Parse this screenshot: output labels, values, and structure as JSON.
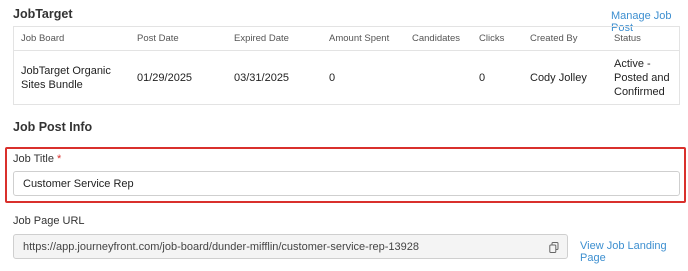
{
  "jobtarget": {
    "title": "JobTarget",
    "manage_link": "Manage Job Post",
    "columns": [
      "Job Board",
      "Post Date",
      "Expired Date",
      "Amount Spent",
      "Candidates",
      "Clicks",
      "Created By",
      "Status"
    ],
    "row": {
      "job_board": "JobTarget Organic Sites Bundle",
      "post_date": "01/29/2025",
      "expired_date": "03/31/2025",
      "amount_spent": "0",
      "candidates": "",
      "clicks": "0",
      "created_by": "Cody Jolley",
      "status": "Active - Posted and Confirmed"
    }
  },
  "job_post_info": {
    "title": "Job Post Info",
    "job_title_label": "Job Title",
    "required_marker": "*",
    "job_title_value": "Customer Service Rep",
    "job_page_url_label": "Job Page URL",
    "job_page_url_value": "https://app.journeyfront.com/job-board/dunder-mifflin/customer-service-rep-13928",
    "view_landing_link": "View Job Landing Page"
  },
  "colors": {
    "accent_link": "#3d8fd0",
    "highlight_border": "#d9302c"
  }
}
